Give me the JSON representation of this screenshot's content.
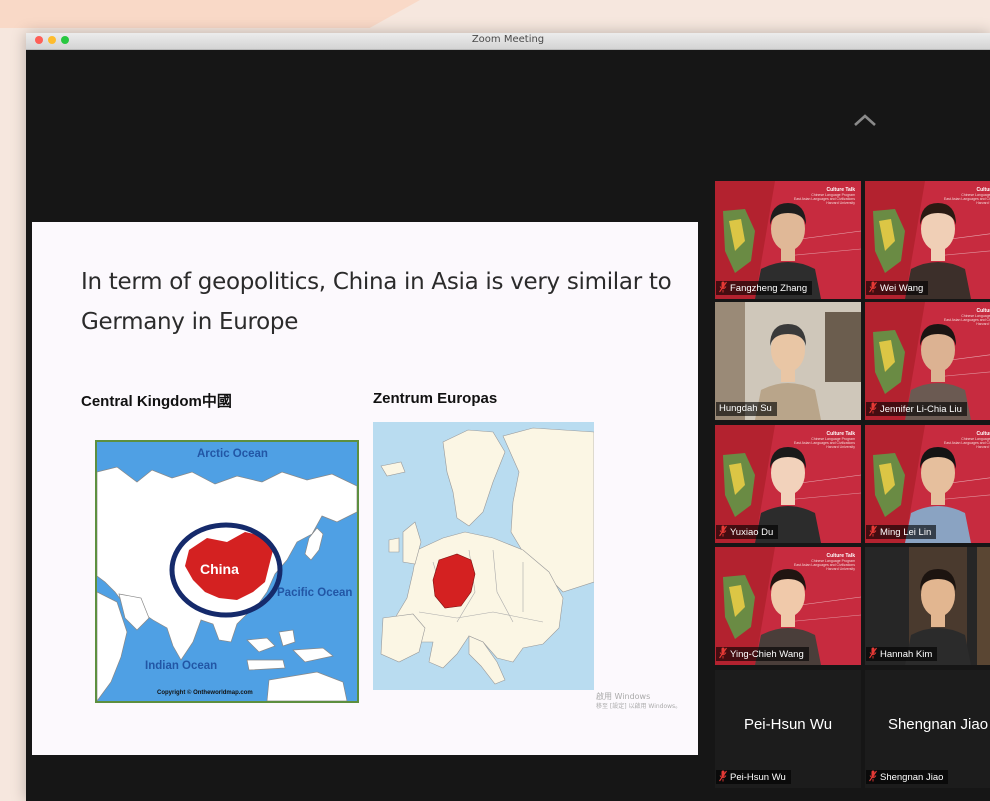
{
  "window": {
    "title": "Zoom Meeting"
  },
  "icons": {
    "scroll_up": "chevron-up-icon",
    "muted_mic": "muted-mic-icon"
  },
  "colors": {
    "active_speaker_border": "#b7d45a",
    "tile_background": "#c72b3f",
    "china": "#d42121",
    "germany": "#d42121"
  },
  "slide": {
    "title_line1": "In term of geopolitics, China in Asia is very similar to",
    "title_line2": "Germany in Europe",
    "left_label": "Central Kingdom中國",
    "right_label": "Zentrum Europas",
    "asia_map": {
      "arctic_ocean": "Arctic Ocean",
      "pacific_ocean": "Pacific Ocean",
      "indian_ocean": "Indian Ocean",
      "china": "China",
      "copyright": "Copyright © Ontheworldmap.com"
    },
    "watermark_line1": "啟用 Windows",
    "watermark_line2": "移至 [設定] 以啟用 Windows。"
  },
  "background_text": {
    "title": "Culture Talk",
    "line1": "Chinese Language Program",
    "line2": "East Asian Languages and Civilizations",
    "line3": "Harvard University"
  },
  "participants": [
    {
      "name": "Fangzheng Zhang",
      "muted": true,
      "active": false
    },
    {
      "name": "Wei Wang",
      "muted": true,
      "active": false
    },
    {
      "name": "Hungdah Su",
      "muted": false,
      "active": true
    },
    {
      "name": "Jennifer Li-Chia Liu",
      "muted": true,
      "active": false
    },
    {
      "name": "Yuxiao Du",
      "muted": true,
      "active": false
    },
    {
      "name": "Ming Lei Lin",
      "muted": true,
      "active": false
    },
    {
      "name": "Ying-Chieh Wang",
      "muted": true,
      "active": false
    },
    {
      "name": "Hannah Kim",
      "muted": true,
      "active": false
    },
    {
      "name": "Pei-Hsun Wu",
      "muted": true,
      "active": false,
      "video_off": true
    },
    {
      "name": "Shengnan Jiao",
      "muted": true,
      "active": false,
      "video_off": true
    }
  ]
}
